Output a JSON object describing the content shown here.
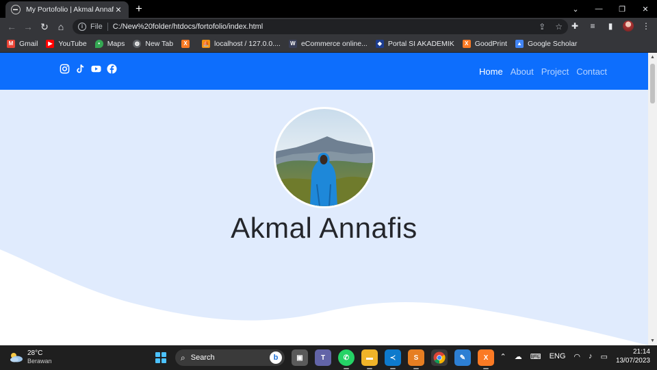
{
  "browser": {
    "tab_title": "My Portofolio | Akmal Annafis",
    "tab_close": "✕",
    "new_tab": "+",
    "window_controls": [
      "⌄",
      "—",
      "❐",
      "✕"
    ],
    "scheme_label": "File",
    "url": "C:/New%20folder/htdocs/fortofolio/index.html",
    "bookmarks": [
      {
        "label": "Gmail",
        "icon": "gmail-icon",
        "color": "#ea4335"
      },
      {
        "label": "YouTube",
        "icon": "youtube-icon",
        "color": "#ff0000"
      },
      {
        "label": "Maps",
        "icon": "maps-icon",
        "color": "#34a853"
      },
      {
        "label": "New Tab",
        "icon": "globe-icon",
        "color": "#5f6368"
      },
      {
        "label": "",
        "icon": "xampp-icon",
        "color": "#fb7a24"
      },
      {
        "label": "localhost / 127.0.0....",
        "icon": "phpmyadmin-icon",
        "color": "#f29111"
      },
      {
        "label": "eCommerce online...",
        "icon": "w3-icon",
        "color": "#3a3f58"
      },
      {
        "label": "Portal SI AKADEMIK",
        "icon": "portal-icon",
        "color": "#1d3d8f"
      },
      {
        "label": "GoodPrint",
        "icon": "xampp-icon",
        "color": "#fb7a24"
      },
      {
        "label": "Google Scholar",
        "icon": "scholar-icon",
        "color": "#4285f4"
      }
    ]
  },
  "site": {
    "social": [
      "instagram-icon",
      "tiktok-icon",
      "youtube-icon",
      "facebook-icon"
    ],
    "menu": [
      {
        "label": "Home",
        "active": true
      },
      {
        "label": "About",
        "active": false
      },
      {
        "label": "Project",
        "active": false
      },
      {
        "label": "Contact",
        "active": false
      }
    ],
    "name": "Akmal Annafis",
    "colors": {
      "primary": "#0d6efd",
      "hero_bg": "#e0ebfd",
      "wave": "#ffffff"
    }
  },
  "taskbar": {
    "temperature": "28°C",
    "weather": "Berawan",
    "search_label": "Search",
    "language": "ENG",
    "time": "21:14",
    "date": "13/07/2023"
  }
}
